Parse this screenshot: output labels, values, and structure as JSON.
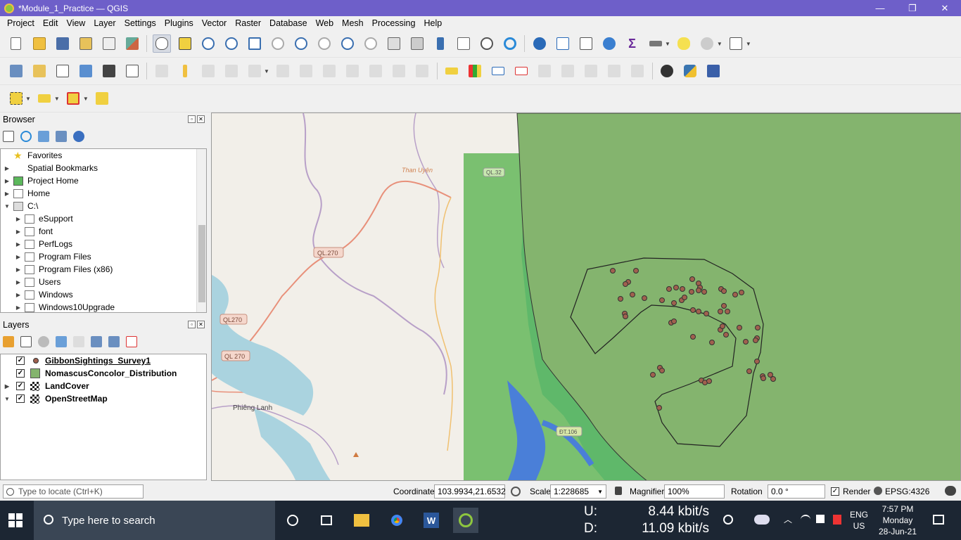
{
  "window": {
    "title": "*Module_1_Practice — QGIS",
    "minimize": "—",
    "restore": "❐",
    "close": "✕"
  },
  "menu": [
    "Project",
    "Edit",
    "View",
    "Layer",
    "Settings",
    "Plugins",
    "Vector",
    "Raster",
    "Database",
    "Web",
    "Mesh",
    "Processing",
    "Help"
  ],
  "browser": {
    "title": "Browser",
    "items": [
      {
        "label": "Favorites",
        "icon": "star-icon",
        "indent": 0,
        "arrow": ""
      },
      {
        "label": "Spatial Bookmarks",
        "icon": "bookmark-icon",
        "indent": 0,
        "arrow": "▶"
      },
      {
        "label": "Project Home",
        "icon": "project-home-icon",
        "indent": 0,
        "arrow": "▶"
      },
      {
        "label": "Home",
        "icon": "home-icon",
        "indent": 0,
        "arrow": "▶"
      },
      {
        "label": "C:\\",
        "icon": "drive-icon",
        "indent": 0,
        "arrow": "▼"
      },
      {
        "label": "eSupport",
        "icon": "folder-icon",
        "indent": 1,
        "arrow": "▶"
      },
      {
        "label": "font",
        "icon": "folder-icon",
        "indent": 1,
        "arrow": "▶"
      },
      {
        "label": "PerfLogs",
        "icon": "folder-icon",
        "indent": 1,
        "arrow": "▶"
      },
      {
        "label": "Program Files",
        "icon": "folder-icon",
        "indent": 1,
        "arrow": "▶"
      },
      {
        "label": "Program Files (x86)",
        "icon": "folder-icon",
        "indent": 1,
        "arrow": "▶"
      },
      {
        "label": "Users",
        "icon": "folder-icon",
        "indent": 1,
        "arrow": "▶"
      },
      {
        "label": "Windows",
        "icon": "folder-icon",
        "indent": 1,
        "arrow": "▶"
      },
      {
        "label": "Windows10Upgrade",
        "icon": "folder-icon",
        "indent": 1,
        "arrow": "▶"
      }
    ]
  },
  "layers": {
    "title": "Layers",
    "items": [
      {
        "label": "GibbonSightings_Survey1",
        "arrow": "",
        "checked": true,
        "symbol": "point-symbol-icon",
        "underline": true
      },
      {
        "label": "NomascusConcolor_Distribution",
        "arrow": "",
        "checked": true,
        "symbol": "polygon-symbol-icon",
        "underline": false
      },
      {
        "label": "LandCover",
        "arrow": "▶",
        "checked": true,
        "symbol": "raster-icon",
        "underline": false
      },
      {
        "label": "OpenStreetMap",
        "arrow": "▼",
        "checked": true,
        "symbol": "raster-icon",
        "underline": false
      }
    ]
  },
  "map": {
    "labels": {
      "than_uyen": "Than Uyên",
      "ql32": "QL.32",
      "ql270_a": "QL.270",
      "ql270_b": "QL270",
      "ql270_c": "QL 270",
      "phieng_lanh": "Phiêng Lanh",
      "dt106": "ĐT.106"
    },
    "colors": {
      "basemap": "#f2efe9",
      "landcover": "#5fb86a",
      "distribution": "#84b46e",
      "water": "#4a7fd8",
      "sighting": "#a0604e"
    }
  },
  "status": {
    "locate_placeholder": "Type to locate (Ctrl+K)",
    "coordinate_label": "Coordinate",
    "coordinate": "103.9934,21.6532",
    "scale_label": "Scale",
    "scale": "1:228685",
    "magnifier_label": "Magnifier",
    "magnifier": "100%",
    "rotation_label": "Rotation",
    "rotation": "0.0 °",
    "render_label": "Render",
    "crs": "EPSG:4326"
  },
  "taskbar": {
    "search_placeholder": "Type here to search",
    "net_up": "U:",
    "net_up_value": "8.44 kbit/s",
    "net_down": "D:",
    "net_down_value": "11.09 kbit/s",
    "lang": "ENG",
    "region": "US",
    "time": "7:57 PM",
    "day": "Monday",
    "date": "28-Jun-21"
  }
}
